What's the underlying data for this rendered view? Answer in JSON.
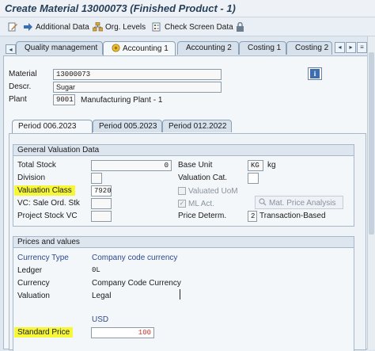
{
  "window": {
    "title": "Create Material 13000073 (Finished Product - 1)"
  },
  "toolbar": {
    "additional_data": "Additional Data",
    "org_levels": "Org. Levels",
    "check_screen_data": "Check Screen Data"
  },
  "tabs": {
    "quality": "Quality management",
    "accounting1": "Accounting 1",
    "accounting2": "Accounting 2",
    "costing1": "Costing 1",
    "costing2": "Costing 2"
  },
  "header": {
    "material_label": "Material",
    "material_value": "13000073",
    "descr_label": "Descr.",
    "descr_value": "Sugar",
    "plant_label": "Plant",
    "plant_value": "9001",
    "plant_name": "Manufacturing Plant - 1"
  },
  "period_tabs": {
    "p1": "Period 006.2023",
    "p2": "Period 005.2023",
    "p3": "Period 012.2022"
  },
  "valuation": {
    "title": "General Valuation Data",
    "total_stock_label": "Total Stock",
    "total_stock_value": "0",
    "base_unit_label": "Base Unit",
    "base_unit_value": "KG",
    "base_unit_text": "kg",
    "division_label": "Division",
    "valuation_cat_label": "Valuation Cat.",
    "valuation_class_label": "Valuation Class",
    "valuation_class_value": "7920",
    "valuated_uom_label": "Valuated UoM",
    "vc_sale_label": "VC: Sale Ord. Stk",
    "ml_act_label": "ML Act.",
    "mat_price_btn": "Mat. Price Analysis",
    "project_stock_label": "Project Stock VC",
    "price_determ_label": "Price Determ.",
    "price_determ_value": "2",
    "price_determ_text": "Transaction-Based"
  },
  "prices": {
    "title": "Prices and values",
    "currency_type_label": "Currency Type",
    "currency_type_value": "Company code currency",
    "ledger_label": "Ledger",
    "ledger_value": "0L",
    "currency_label": "Currency",
    "currency_value": "Company Code Currency",
    "valuation_label": "Valuation",
    "valuation_value": "Legal",
    "currency_code_label": "Currency",
    "currency_code_value": "USD",
    "standard_price_label": "Standard Price",
    "standard_price_value": "100"
  },
  "colors": {
    "highlight": "#f7f73a",
    "blue_text": "#2c4a8c",
    "price_red": "#c0392b"
  }
}
